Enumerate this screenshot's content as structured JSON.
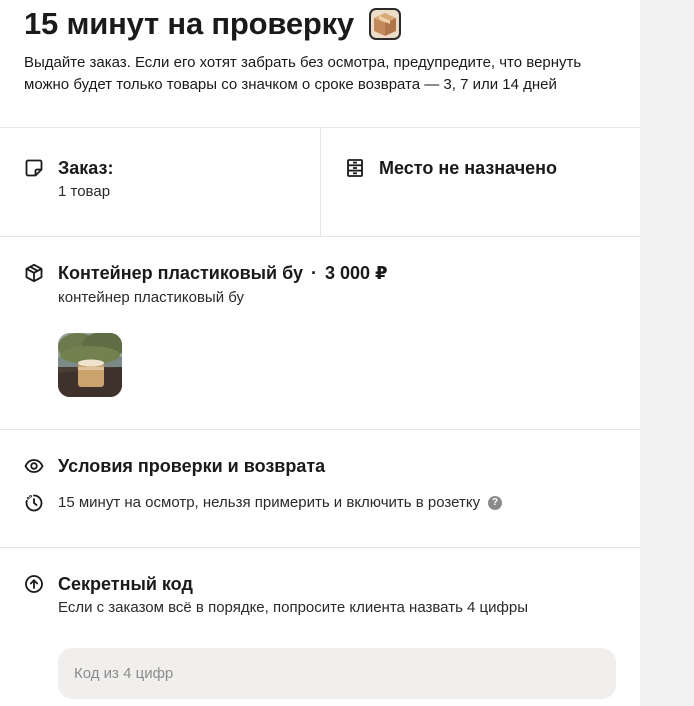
{
  "header": {
    "title": "15 минут на проверку",
    "subtitle_line1": "Выдайте заказ. Если его хотят забрать без осмотра, предупредите, что вернуть",
    "subtitle_line2": "можно будет только товары со значком о сроке возврата — 3, 7 или 14 дней"
  },
  "order": {
    "title": "Заказ:",
    "count": "1 товар"
  },
  "place": {
    "title": "Место не назначено"
  },
  "item": {
    "name": "Контейнер пластиковый бу",
    "separator": "·",
    "price": "3 000 ₽",
    "description": "контейнер пластиковый бу"
  },
  "conditions": {
    "title": "Условия проверки и возврата",
    "text": "15 минут на осмотр, нельзя примерить и включить в розетку",
    "help_glyph": "?"
  },
  "secret": {
    "title": "Секретный код",
    "text": "Если с заказом всё в порядке, попросите клиента назвать 4 цифры",
    "input_placeholder": "Код из 4 цифр",
    "input_value": ""
  },
  "icons": {
    "title_icon": "cardboard-box-icon",
    "order_icon": "sticky-note-icon",
    "place_icon": "shelf-icon",
    "item_icon": "package-icon",
    "conditions_icon": "eye-icon",
    "timer_icon": "timer-icon",
    "secret_icon": "arrow-up-circle-icon"
  },
  "colors": {
    "panel": "#ffffff",
    "background": "#f2f2f2",
    "input_bg": "#f0efed",
    "divider": "#e6e6e6"
  }
}
